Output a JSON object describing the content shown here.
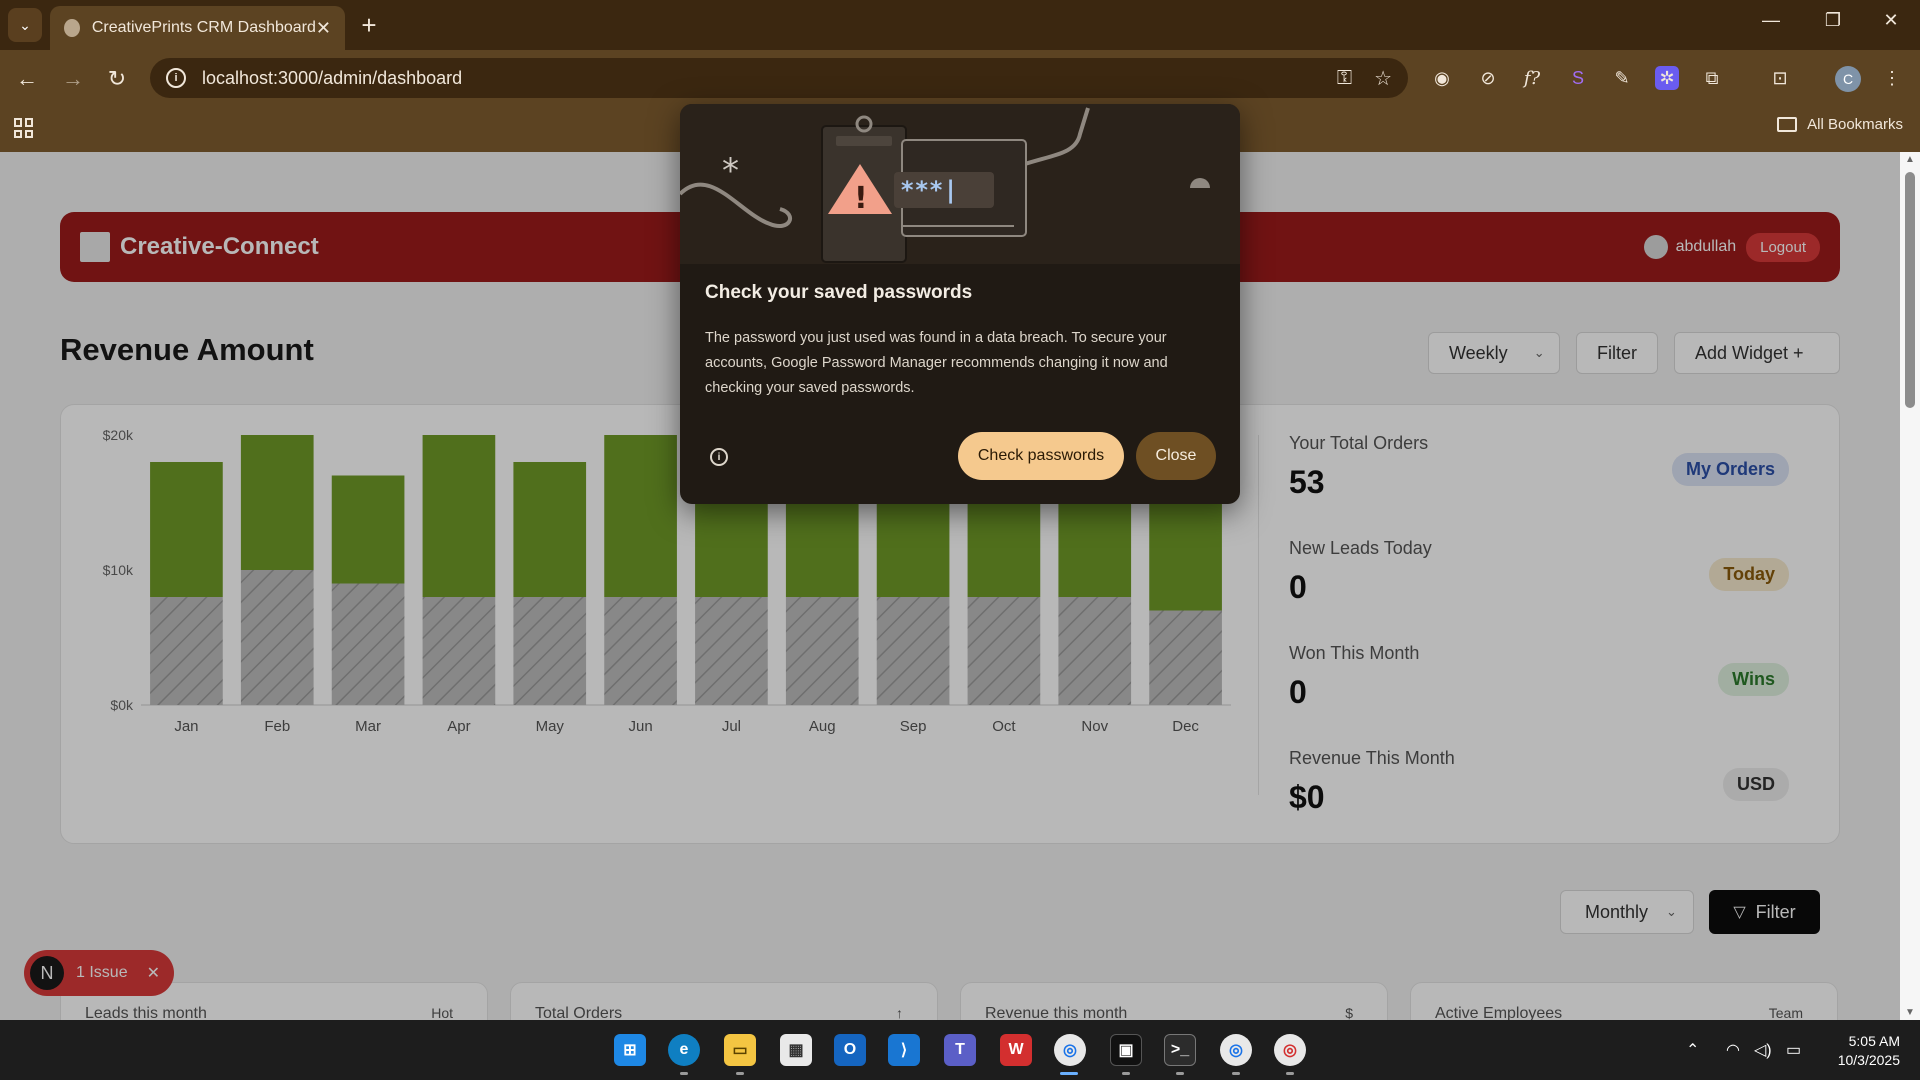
{
  "browser": {
    "tab_title": "CreativePrints CRM Dashboard",
    "tab_close": "✕",
    "new_tab": "+",
    "url": "localhost:3000/admin/dashboard",
    "bookmarks_label": "All Bookmarks",
    "profile_initial": "C"
  },
  "app": {
    "brand": "Creative-Connect",
    "username": "abdullah",
    "logout_label": "Logout"
  },
  "revenue": {
    "title": "Revenue Amount",
    "period_select": "Weekly",
    "filter_label": "Filter",
    "add_widget_label": "Add Widget +"
  },
  "chart_data": {
    "type": "bar",
    "stacked": true,
    "categories": [
      "Jan",
      "Feb",
      "Mar",
      "Apr",
      "May",
      "Jun",
      "Jul",
      "Aug",
      "Sep",
      "Oct",
      "Nov",
      "Dec"
    ],
    "series": [
      {
        "values": [
          8000,
          10000,
          9000,
          8000,
          8000,
          8000,
          8000,
          8000,
          8000,
          8000,
          8000,
          7000
        ],
        "color": "#bdbdbd",
        "pattern": "hatched"
      },
      {
        "values": [
          10000,
          10000,
          8000,
          12000,
          10000,
          12000,
          12000,
          12000,
          12000,
          12000,
          12000,
          13000
        ],
        "color": "#6f9a28"
      }
    ],
    "y_ticks": [
      "$0k",
      "$10k",
      "$20k"
    ],
    "ylim": [
      0,
      20000
    ],
    "grid": false
  },
  "kpis": [
    {
      "label": "Your Total Orders",
      "value": "53",
      "badge": "My Orders",
      "badge_bg": "#dbe3f6",
      "badge_color": "#2b4fa8"
    },
    {
      "label": "New Leads Today",
      "value": "0",
      "badge": "Today",
      "badge_bg": "#f7ebcf",
      "badge_color": "#8a5a0a"
    },
    {
      "label": "Won This Month",
      "value": "0",
      "badge": "Wins",
      "badge_bg": "#dff1df",
      "badge_color": "#2b7a2b"
    },
    {
      "label": "Revenue This Month",
      "value": "$0",
      "badge": "USD",
      "badge_bg": "#eeeeee",
      "badge_color": "#333333"
    }
  ],
  "lower": {
    "period_select": "Monthly",
    "filter_label": "Filter",
    "cards": [
      {
        "label": "Leads this month",
        "tag": "Hot"
      },
      {
        "label": "Total Orders",
        "tag": "↑"
      },
      {
        "label": "Revenue this month",
        "tag": "$"
      },
      {
        "label": "Active Employees",
        "tag": "Team"
      }
    ]
  },
  "issue_badge": {
    "logo": "N",
    "text": "1 Issue",
    "close": "✕"
  },
  "dialog": {
    "title": "Check your saved passwords",
    "body": "The password you just used was found in a data breach. To secure your accounts, Google Password Manager recommends changing it now and checking your saved passwords.",
    "primary_label": "Check passwords",
    "secondary_label": "Close",
    "illustration_text": "***|"
  },
  "taskbar": {
    "time": "5:05 AM",
    "date": "10/3/2025"
  },
  "colors": {
    "header_red": "#9d1b1b",
    "chart_green": "#6f9a28",
    "chart_gray": "#bdbdbd",
    "browser_frame": "#5c4322"
  }
}
